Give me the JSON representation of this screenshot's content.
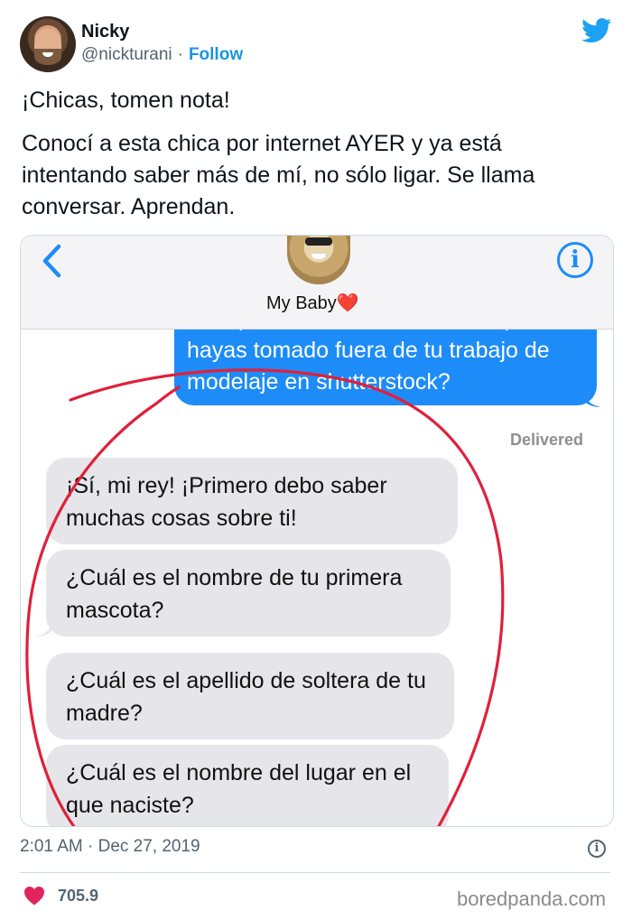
{
  "author": {
    "name": "Nicky",
    "handle": "@nickturani",
    "separator": "·",
    "follow_label": "Follow"
  },
  "tweet": {
    "line1": "¡Chicas, tomen nota!",
    "line2": "Conocí a esta chica por internet AYER y ya está intentando saber más de mí, no sólo ligar. Se llama conversar. Aprendan."
  },
  "imessage": {
    "contact_name": "My Baby",
    "contact_emoji": "❤️",
    "info_glyph": "i",
    "outgoing_message": "¿Me puedes enviar unas fotos que te hayas tomado fuera de tu trabajo de modelaje en shutterstock?",
    "delivered_label": "Delivered",
    "incoming_messages": [
      "¡Sí, mi rey! ¡Primero debo saber muchas cosas sobre ti!",
      "¿Cuál es el nombre de tu primera mascota?",
      "¿Cuál es el apellido de soltera de tu madre?",
      "¿Cuál es el nombre del lugar en el que naciste?"
    ],
    "accent_color": "#1d8cf8",
    "annotation_color": "#e0203a"
  },
  "footer": {
    "timestamp": "2:01 AM · Dec 27, 2019",
    "like_count": "705.9",
    "watermark": "boredpanda.com"
  },
  "colors": {
    "follow": "#1b95e0",
    "like_heart": "#e0245e",
    "twitter_bird": "#1da1f2"
  }
}
